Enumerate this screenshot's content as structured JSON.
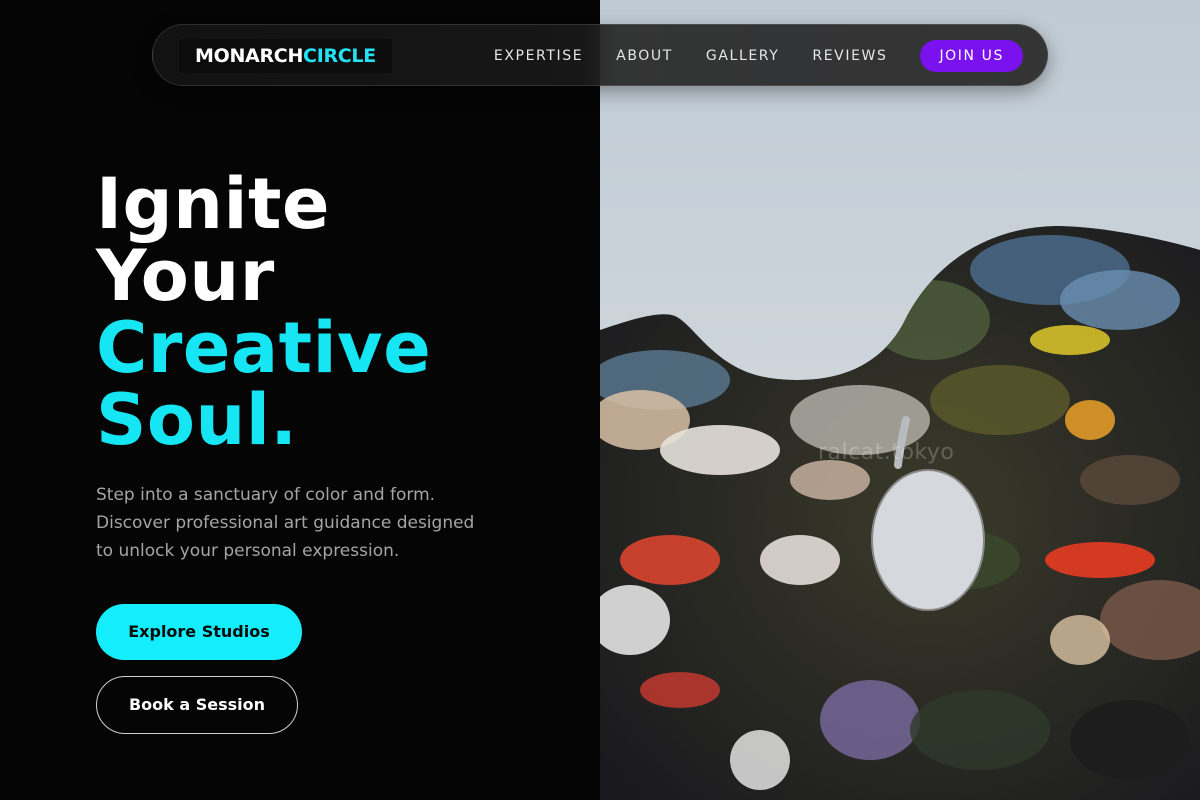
{
  "brand": {
    "part1": "MONARCH",
    "part2": "CIRCLE"
  },
  "nav": {
    "links": [
      "EXPERTISE",
      "ABOUT",
      "GALLERY",
      "REVIEWS"
    ],
    "cta": "JOIN US"
  },
  "hero": {
    "title_lines": [
      "Ignite",
      "Your",
      "Creative",
      "Soul."
    ],
    "description_lines": [
      "Step into a sanctuary of color and form.",
      "Discover professional art guidance designed",
      "to unlock your personal expression."
    ],
    "primary_button": "Explore Studios",
    "secondary_button": "Book a Session"
  },
  "image": {
    "watermark": "ralcat.tokyo"
  },
  "colors": {
    "accent_cyan": "#16e6f4",
    "accent_purple": "#7a12f0",
    "background": "#050505"
  }
}
